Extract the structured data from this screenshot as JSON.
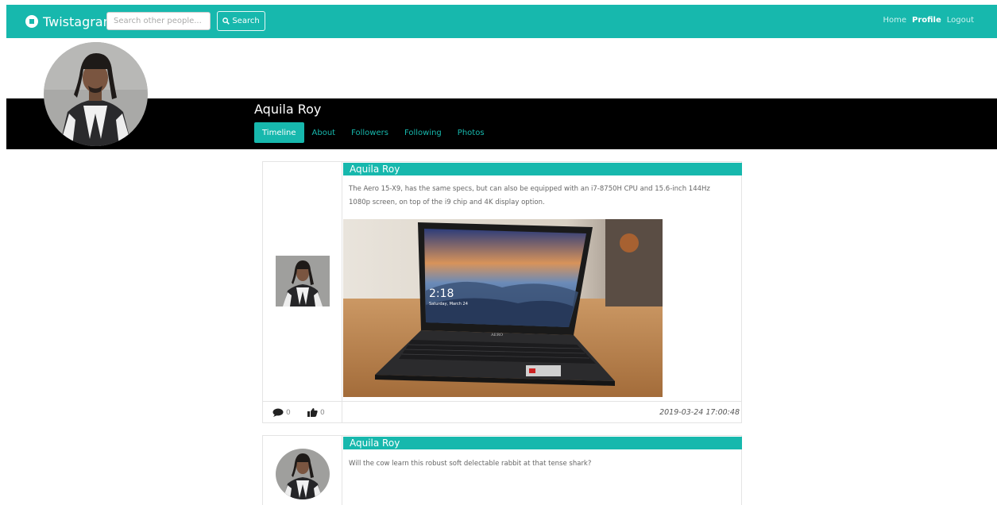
{
  "navbar": {
    "brand": "Twistagram",
    "search_placeholder": "Search other people...",
    "search_button": "Search",
    "links": [
      "Home",
      "Profile",
      "Logout"
    ],
    "active_link": "Profile",
    "color": "#17b8ad"
  },
  "profile": {
    "name": "Aquila Roy",
    "tabs": [
      "Timeline",
      "About",
      "Followers",
      "Following",
      "Photos"
    ],
    "active_tab": "Timeline"
  },
  "posts": [
    {
      "author": "Aquila Roy",
      "text": "The Aero 15-X9, has the same specs, but can also be equipped with an i7-8750H CPU and 15.6-inch 144Hz 1080p screen, on top of the i9 chip and 4K display option.",
      "image_clock": "2:18",
      "image_date": "Saturday, March 24",
      "image_brand": "AERO",
      "comments": "0",
      "likes": "0",
      "timestamp": "2019-03-24 17:00:48"
    },
    {
      "author": "Aquila Roy",
      "text": "Will the cow learn this robust soft delectable rabbit at that tense shark?"
    }
  ]
}
